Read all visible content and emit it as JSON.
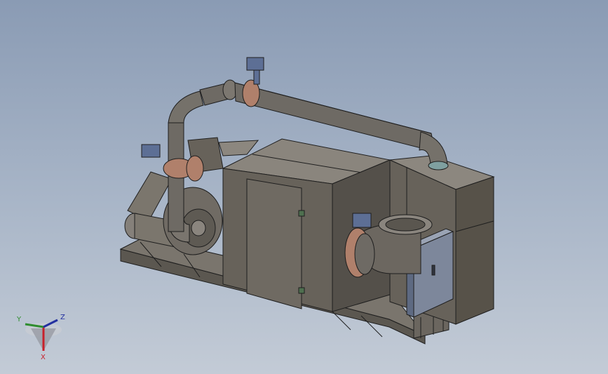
{
  "viewport": {
    "background_top": "#8a9bb4",
    "background_bottom": "#c3cbd6"
  },
  "model": {
    "body_color": "#67625a",
    "body_light": "#7b766d",
    "body_dark": "#514c45",
    "pipe_color": "#6e6a64",
    "flange_color": "#b0806b",
    "actuator_color": "#5d6f95",
    "edge_color": "#1e1e1e"
  },
  "triad": {
    "x_label": "X",
    "y_label": "Y",
    "z_label": "Z",
    "x_color": "#c8202a",
    "y_color": "#2f8d2f",
    "z_color": "#2430a0"
  }
}
